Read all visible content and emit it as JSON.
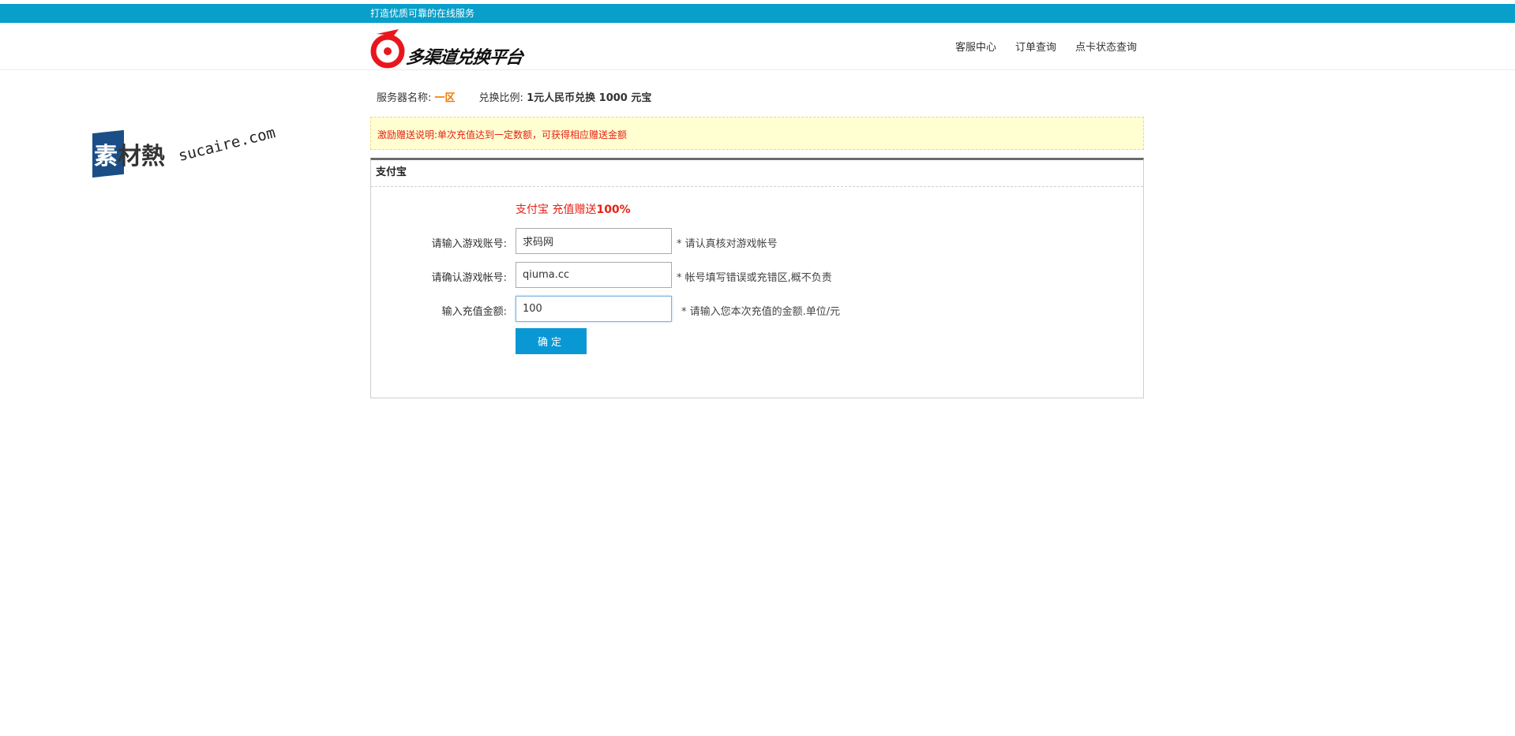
{
  "topbar": {
    "slogan": "打造优质可靠的在线服务"
  },
  "header": {
    "logo_text": "多渠道兑换平台",
    "nav": [
      "客服中心",
      "订单查询",
      "点卡状态查询"
    ]
  },
  "watermark": {
    "cn_first": "素",
    "cn_rest": "材熱",
    "en": "sucaire.com"
  },
  "info": {
    "server_label": "服务器名称:",
    "server_value": "一区",
    "ratio_label": "兑换比例:",
    "ratio_value": "1元人民币兑换 1000 元宝"
  },
  "notice": {
    "text": "激励赠送说明:单次充值达到一定数额，可获得相应赠送金额"
  },
  "panel": {
    "title": "支付宝",
    "promo_prefix": "支付宝 充值赠送",
    "promo_value": "100%",
    "fields": [
      {
        "label": "请输入游戏账号:",
        "value": "求码网",
        "hint": "* 请认真核对游戏帐号"
      },
      {
        "label": "请确认游戏帐号:",
        "value": "qiuma.cc",
        "hint": "* 帐号填写错误或充错区,概不负责"
      },
      {
        "label": "输入充值金额:",
        "value": "100",
        "hint": "* 请输入您本次充值的金额.单位/元"
      }
    ],
    "submit_label": "确定"
  },
  "colors": {
    "topbar": "#089fca",
    "accent_orange": "#f07800",
    "notice_bg": "#ffffd2",
    "notice_text": "#e52214",
    "button": "#0a98d4"
  }
}
